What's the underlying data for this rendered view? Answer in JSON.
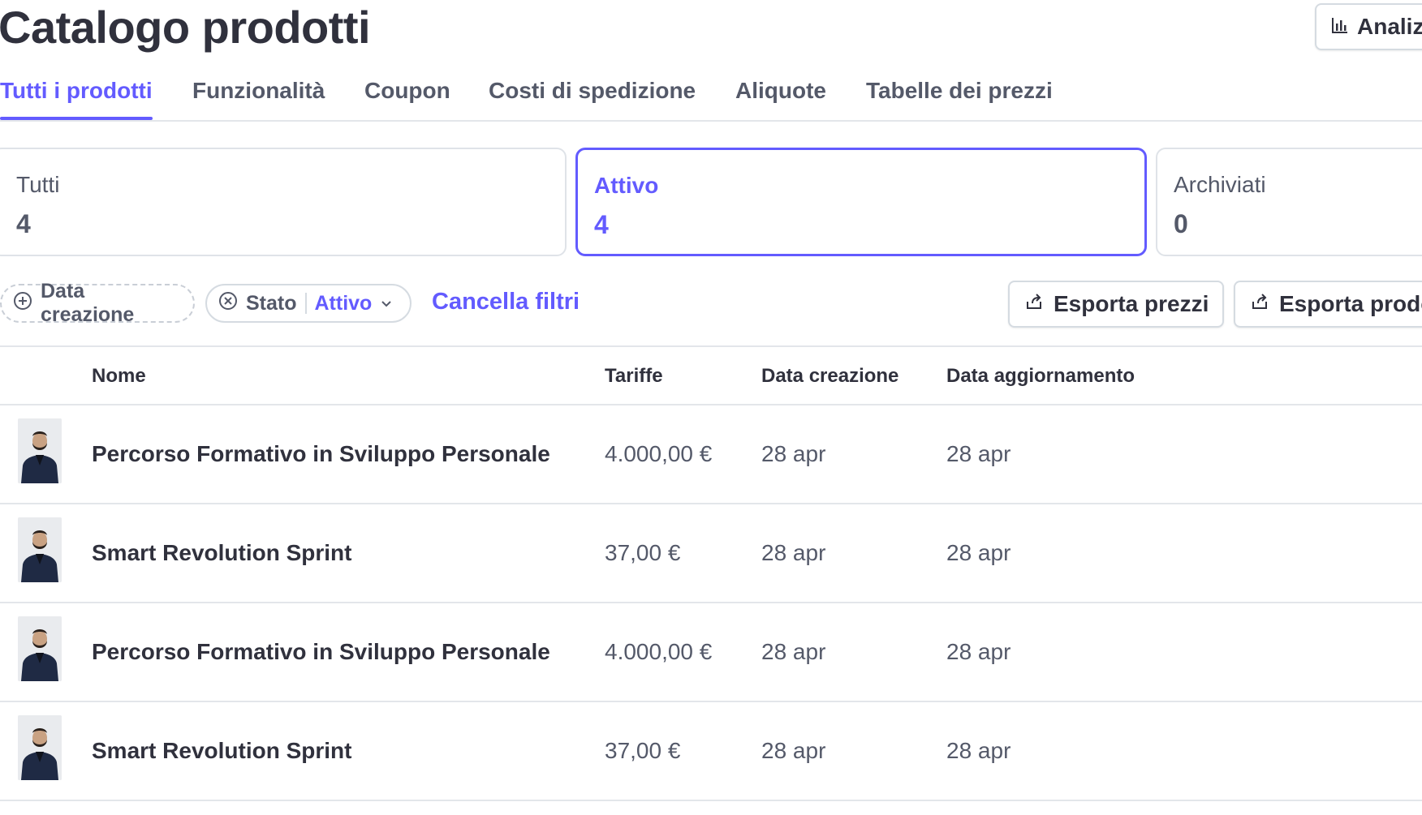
{
  "header": {
    "title": "Catalogo prodotti",
    "analytics_label": "Analiz"
  },
  "tabs": [
    {
      "label": "Tutti i prodotti",
      "active": true
    },
    {
      "label": "Funzionalità",
      "active": false
    },
    {
      "label": "Coupon",
      "active": false
    },
    {
      "label": "Costi di spedizione",
      "active": false
    },
    {
      "label": "Aliquote",
      "active": false
    },
    {
      "label": "Tabelle dei prezzi",
      "active": false
    }
  ],
  "status_cards": [
    {
      "label": "Tutti",
      "count": "4",
      "selected": false
    },
    {
      "label": "Attivo",
      "count": "4",
      "selected": true
    },
    {
      "label": "Archiviati",
      "count": "0",
      "selected": false
    }
  ],
  "filters": {
    "created_chip": "Data creazione",
    "status_chip": {
      "label": "Stato",
      "value": "Attivo"
    },
    "clear_label": "Cancella filtri",
    "export_prices_label": "Esporta prezzi",
    "export_products_label": "Esporta prodo"
  },
  "table": {
    "headers": {
      "name": "Nome",
      "prices": "Tariffe",
      "created": "Data creazione",
      "updated": "Data aggiornamento"
    },
    "rows": [
      {
        "name": "Percorso Formativo in Sviluppo Personale",
        "price": "4.000,00 €",
        "created": "28 apr",
        "updated": "28 apr"
      },
      {
        "name": "Smart Revolution Sprint",
        "price": "37,00 €",
        "created": "28 apr",
        "updated": "28 apr"
      },
      {
        "name": "Percorso Formativo in Sviluppo Personale",
        "price": "4.000,00 €",
        "created": "28 apr",
        "updated": "28 apr"
      },
      {
        "name": "Smart Revolution Sprint",
        "price": "37,00 €",
        "created": "28 apr",
        "updated": "28 apr"
      }
    ]
  },
  "colors": {
    "accent": "#635bff",
    "text_primary": "#30313d",
    "text_secondary": "#545969",
    "border": "#e3e6ea"
  }
}
